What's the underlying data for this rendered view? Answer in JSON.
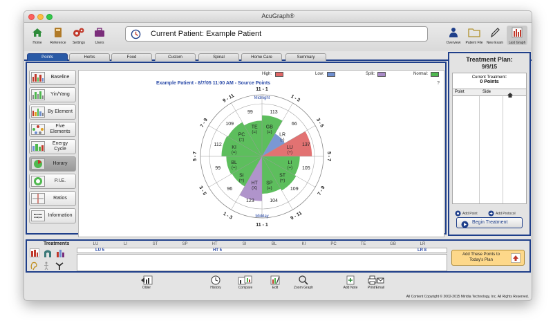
{
  "window": {
    "title": "AcuGraph®"
  },
  "toolbar": {
    "left": [
      {
        "label": "Home",
        "icon": "home-icon"
      },
      {
        "label": "Reference",
        "icon": "book-icon"
      },
      {
        "label": "Settings",
        "icon": "gears-icon"
      },
      {
        "label": "Users",
        "icon": "briefcase-icon"
      }
    ],
    "patient_label": "Current Patient:  Example Patient",
    "right": [
      {
        "label": "Overview",
        "icon": "person-icon"
      },
      {
        "label": "Patient File",
        "icon": "folder-icon"
      },
      {
        "label": "New Exam",
        "icon": "pen-icon"
      },
      {
        "label": "Last Graph",
        "icon": "bar-graph-icon"
      }
    ]
  },
  "tabs": [
    "Points",
    "Herbs",
    "Food",
    "Custom",
    "Spinal",
    "Home Care",
    "Summary"
  ],
  "sidebar": [
    {
      "label": "Baseline"
    },
    {
      "label": "Yin/Yang"
    },
    {
      "label": "By Element"
    },
    {
      "label": "Five Elements"
    },
    {
      "label": "Energy Cycle"
    },
    {
      "label": "Horary"
    },
    {
      "label": "P.I.E."
    },
    {
      "label": "Ratios"
    },
    {
      "label": "Information",
      "icon_text": "Meridian Analysis"
    }
  ],
  "legend": {
    "high": "High:",
    "low": "Low:",
    "split": "Split:",
    "normal": "Normal:"
  },
  "colors": {
    "high": "#e06666",
    "low": "#6f8fd0",
    "split": "#a98bc7",
    "normal": "#4fb84f",
    "accent": "#1f3f8a"
  },
  "chart_title": "Example Patient - 8/7/05 11:00 AM - Source Points",
  "chart_help": "?",
  "chart_data": {
    "type": "radial",
    "labels": {
      "top": "Midnight",
      "bottom": "Midday"
    },
    "time_ranges": [
      "11 - 1",
      "1 - 3",
      "3 - 5",
      "5 - 7",
      "7 - 9",
      "9 - 11",
      "11 - 1",
      "1 - 3",
      "3 - 5",
      "5 - 7",
      "7 - 9",
      "9 - 11"
    ],
    "meridians": [
      {
        "name": "GB",
        "value": 113,
        "status": "(=)",
        "color": "normal",
        "radius": 0.78
      },
      {
        "name": "LR",
        "value": 66,
        "status": "(-)",
        "color": "low",
        "radius": 0.5
      },
      {
        "name": "LU",
        "value": 137,
        "status": "(+)",
        "color": "high",
        "radius": 0.95
      },
      {
        "name": "LI",
        "value": 105,
        "status": "(=)",
        "color": "normal",
        "radius": 0.72
      },
      {
        "name": "ST",
        "value": 109,
        "status": "(=)",
        "color": "normal",
        "radius": 0.75
      },
      {
        "name": "SP",
        "value": 104,
        "status": "(=)",
        "color": "normal",
        "radius": 0.71
      },
      {
        "name": "HT",
        "value": 123,
        "status": "(X)",
        "color": "split",
        "radius": 0.85
      },
      {
        "name": "SI",
        "value": 96,
        "status": "(=)",
        "color": "normal",
        "radius": 0.66
      },
      {
        "name": "BL",
        "value": 99,
        "status": "(=)",
        "color": "normal",
        "radius": 0.68
      },
      {
        "name": "KI",
        "value": 112,
        "status": "(=)",
        "color": "normal",
        "radius": 0.77
      },
      {
        "name": "PC",
        "value": 109,
        "status": "(=)",
        "color": "normal",
        "radius": 0.75
      },
      {
        "name": "TE",
        "value": 99,
        "status": "(=)",
        "color": "normal",
        "radius": 0.68
      }
    ]
  },
  "treatment_plan": {
    "title": "Treatment Plan:",
    "date": "9/9/15",
    "current_label": "Current Treatment:",
    "points_label": "0 Points",
    "col_point": "Point",
    "col_side": "Side",
    "add_point": "Add Point",
    "add_protocol": "Add Protocol",
    "begin": "Begin Treatment"
  },
  "treatments": {
    "title": "Treatments",
    "meridians": [
      "LU",
      "LI",
      "ST",
      "SP",
      "HT",
      "SI",
      "BL",
      "KI",
      "PC",
      "TE",
      "GB",
      "LR"
    ],
    "points": [
      {
        "label": "LU 5",
        "column": "LU"
      },
      {
        "label": "HT 5",
        "column": "HT"
      },
      {
        "label": "LR 8",
        "column": "LR"
      }
    ],
    "add_button": "Add These Points to Today's Plan"
  },
  "actions": [
    {
      "label": "Older",
      "icon": "back-graph-icon"
    },
    {
      "label": "History",
      "icon": "clock-icon"
    },
    {
      "label": "Compare",
      "icon": "compare-icon"
    },
    {
      "label": "Edit",
      "icon": "edit-graph-icon"
    },
    {
      "label": "Zoom Graph",
      "icon": "magnifier-icon"
    },
    {
      "label": "Add Note",
      "icon": "note-icon"
    },
    {
      "label": "Print/Email",
      "icon": "printer-icon"
    }
  ],
  "copyright": "All Content Copyright © 2002-2015 Miridia Technology, Inc. All Rights Reserved."
}
